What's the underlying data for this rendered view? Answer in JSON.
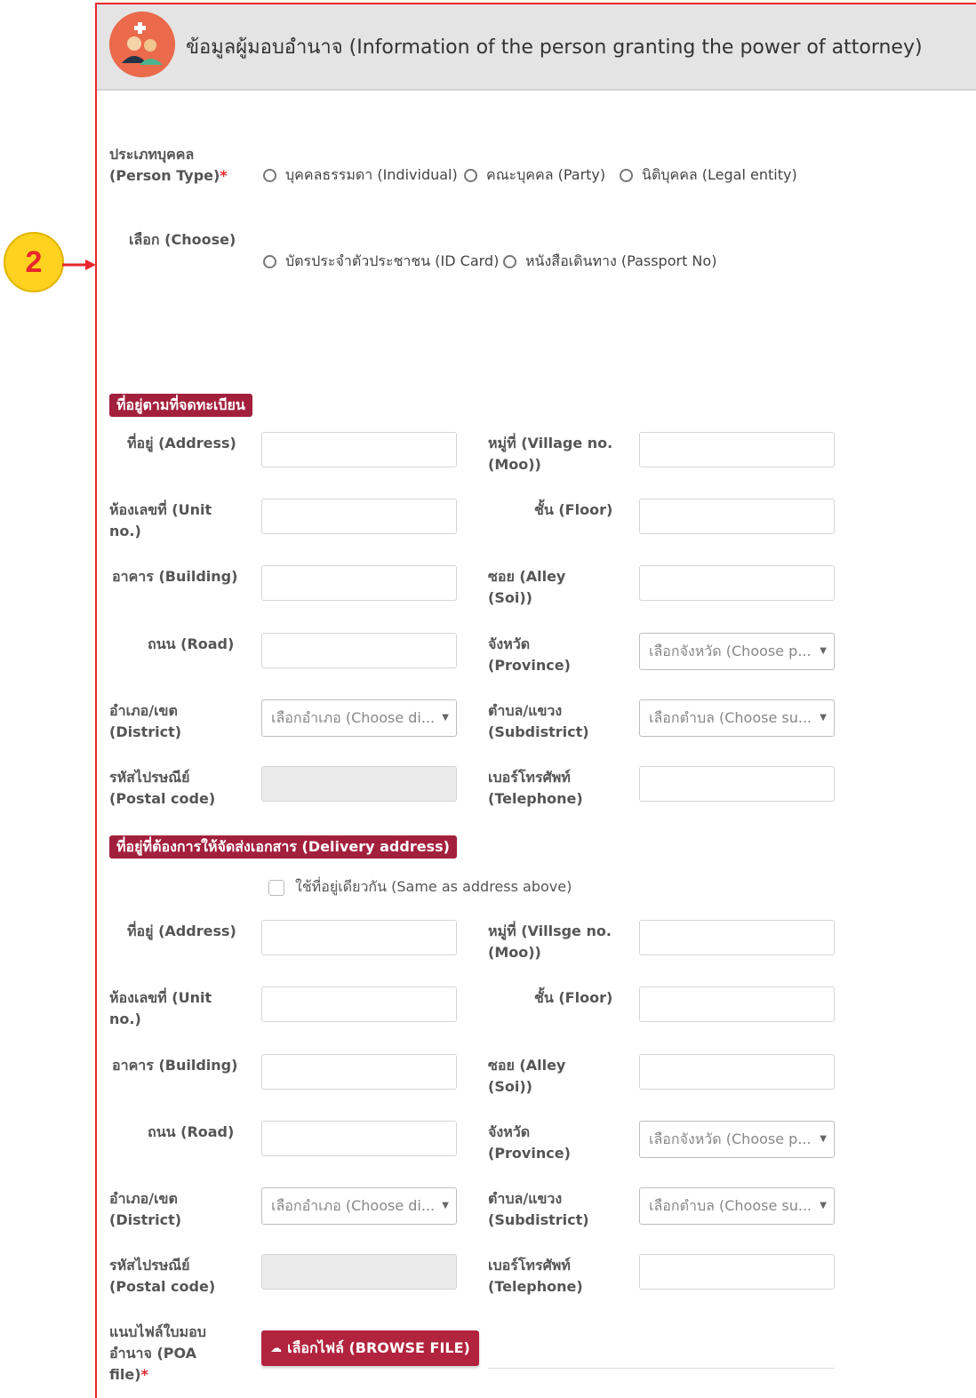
{
  "header": {
    "title": "ข้อมูลผู้มอบอำนาจ (Information of the person granting the power of attorney)"
  },
  "marker": {
    "number": "2"
  },
  "person_type": {
    "label": "ประเภทบุคคล\n(Person Type)",
    "required": "*",
    "options": [
      "บุคคลธรรมดา (Individual)",
      "คณะบุคคล (Party)",
      "นิติบุคคล (Legal entity)"
    ]
  },
  "choose": {
    "label": "เลือก (Choose)",
    "options": [
      "บัตรประจำตัวประชาชน (ID Card)",
      "หนังสือเดินทาง (Passport No)"
    ]
  },
  "registered_address": {
    "title": "ที่อยู่ตามที่จดทะเบียน",
    "address_label": "ที่อยู่ (Address)",
    "moo_label": "หมู่ที่ (Village no.\n(Moo))",
    "unit_label": "ห้องเลขที่ (Unit\nno.)",
    "floor_label": "ชั้น (Floor)",
    "building_label": "อาคาร (Building)",
    "soi_label": "ซอย (Alley\n(Soi))",
    "road_label": "ถนน (Road)",
    "province_label": "จังหวัด\n(Province)",
    "province_placeholder": "เลือกจังหวัด (Choose p...",
    "district_label": "อำเภอ/เขต\n(District)",
    "district_placeholder": "เลือกอำเภอ (Choose di...",
    "subdistrict_label": "ตำบล/แขวง\n(Subdistrict)",
    "subdistrict_placeholder": "เลือกตำบล (Choose su...",
    "postal_label": "รหัสไปรษณีย์\n(Postal code)",
    "telephone_label": "เบอร์โทรศัพท์\n(Telephone)"
  },
  "delivery_address": {
    "title": "ที่อยู่ที่ต้องการให้จัดส่งเอกสาร (Delivery address)",
    "same_checkbox": "ใช้ที่อยู่เดียวกัน (Same as address above)",
    "address_label": "ที่อยู่ (Address)",
    "moo_label": "หมู่ที่ (Villsge no.\n(Moo))",
    "unit_label": "ห้องเลขที่ (Unit\nno.)",
    "floor_label": "ชั้น (Floor)",
    "building_label": "อาคาร (Building)",
    "soi_label": "ซอย (Alley\n(Soi))",
    "road_label": "ถนน (Road)",
    "province_label": "จังหวัด\n(Province)",
    "province_placeholder": "เลือกจังหวัด (Choose p...",
    "district_label": "อำเภอ/เขต\n(District)",
    "district_placeholder": "เลือกอำเภอ (Choose di...",
    "subdistrict_label": "ตำบล/แขวง\n(Subdistrict)",
    "subdistrict_placeholder": "เลือกตำบล (Choose su...",
    "postal_label": "รหัสไปรษณีย์\n(Postal code)",
    "telephone_label": "เบอร์โทรศัพท์\n(Telephone)"
  },
  "poa_file": {
    "label": "แนบไฟล์ใบมอบ\nอำนาจ (POA\nfile)",
    "required": "*",
    "button": "เลือกไฟล์ (BROWSE FILE)"
  },
  "colors": {
    "frame_border": "#e8262b",
    "section_badge": "#a3203c",
    "button": "#b2233d",
    "marker": "#ffd21f"
  }
}
